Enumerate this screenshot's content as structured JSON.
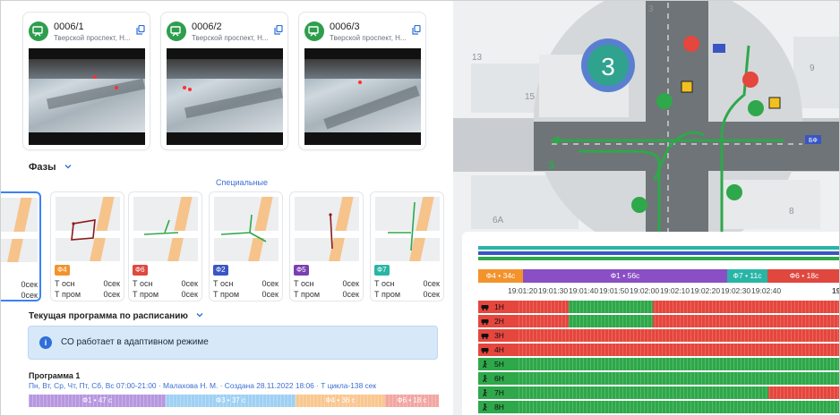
{
  "cameras": [
    {
      "id": "0006/1",
      "address": "Тверской проспект, Н..."
    },
    {
      "id": "0006/2",
      "address": "Тверской проспект, Н..."
    },
    {
      "id": "0006/3",
      "address": "Тверской проспект, Н..."
    }
  ],
  "phases": {
    "title": "Фазы",
    "special_label": "Специальные",
    "main_label": "Т осн",
    "intermediate_label": "Т пром",
    "items": [
      {
        "tag": "",
        "t_main": "0сек",
        "t_inter": "0сек",
        "color": "#ffffff"
      },
      {
        "tag": "Ф4",
        "t_main": "0сек",
        "t_inter": "0сек",
        "color": "#f3932b"
      },
      {
        "tag": "Ф6",
        "t_main": "0сек",
        "t_inter": "0сек",
        "color": "#e0473f"
      },
      {
        "tag": "Ф2",
        "t_main": "0сек",
        "t_inter": "0сек",
        "color": "#3a56c5"
      },
      {
        "tag": "Ф5",
        "t_main": "0сек",
        "t_inter": "0сек",
        "color": "#7a3fb0"
      },
      {
        "tag": "Ф7",
        "t_main": "0сек",
        "t_inter": "0сек",
        "color": "#28b5a6"
      }
    ]
  },
  "schedule": {
    "title": "Текущая программа по расписанию",
    "alert": "СО работает в адаптивном режиме",
    "program_title": "Программа 1",
    "program_sub": "Пн, Вт, Ср, Чт, Пт, Сб, Вс 07:00-21:00 · Малахова Н. М. · Создана 28.11.2022 18:06 · Т цикла-138 сек",
    "timeline": [
      {
        "label": "Ф1 • 47 с",
        "color": "#b797e0"
      },
      {
        "label": "Ф3 • 37 с",
        "color": "#9fd0f4"
      },
      {
        "label": "Ф4 • 36 с",
        "color": "#f9c790"
      },
      {
        "label": "Ф6 • 18 с",
        "color": "#f2a6a2"
      }
    ]
  },
  "map": {
    "labels": [
      "13",
      "15",
      "3",
      "6А",
      "9",
      "8"
    ],
    "intersection_number": "3",
    "direction_number": "3",
    "plate": "БФ"
  },
  "gantt": {
    "phases": [
      {
        "label": "Ф4 • 34с",
        "color": "#f3932b"
      },
      {
        "label": "Ф1 • 56с",
        "color": "#8a4fc4"
      },
      {
        "label": "Ф7 • 11с",
        "color": "#28b5a6"
      },
      {
        "label": "Ф6 • 18с",
        "color": "#e0473f"
      }
    ],
    "times": [
      "19:01:20",
      "19:01:30",
      "19:01:40",
      "19:01:50",
      "19:02:00",
      "19:02:10",
      "19:02:20",
      "19:02:30",
      "19:02:40",
      "19"
    ],
    "rows": [
      {
        "label": "1Н",
        "kind": "car",
        "green": [
          13,
          35
        ],
        "total": 84
      },
      {
        "label": "2Н",
        "kind": "car",
        "green": [
          13,
          35
        ],
        "total": 84
      },
      {
        "label": "3Н",
        "kind": "car",
        "green": null,
        "total": 84
      },
      {
        "label": "4Н",
        "kind": "car",
        "green": null,
        "total": 84
      },
      {
        "label": "5Н",
        "kind": "ped",
        "green": [
          0,
          84
        ],
        "total": 84
      },
      {
        "label": "6Н",
        "kind": "ped",
        "green": [
          0,
          84
        ],
        "total": 84
      },
      {
        "label": "7Н",
        "kind": "ped",
        "green": [
          0,
          65
        ],
        "total": 84
      },
      {
        "label": "8Н",
        "kind": "ped",
        "green": [
          0,
          84
        ],
        "total": 84
      }
    ]
  },
  "colors": {
    "green": "#2ea84a",
    "red": "#e5463d",
    "accent": "#3b82f6"
  }
}
